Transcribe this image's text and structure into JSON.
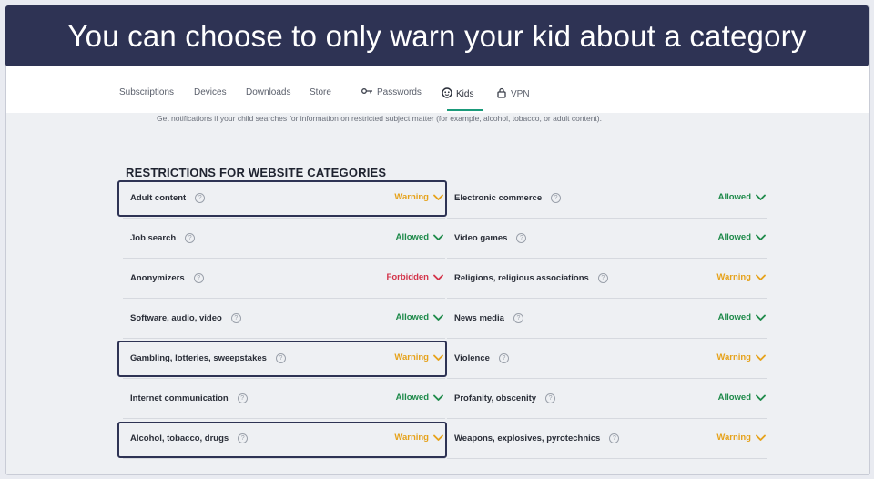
{
  "banner": {
    "text": "You can choose to only warn your kid about a category"
  },
  "nav": {
    "items": [
      {
        "label": "Subscriptions",
        "icon": null
      },
      {
        "label": "Devices",
        "icon": null
      },
      {
        "label": "Downloads",
        "icon": null
      },
      {
        "label": "Store",
        "icon": null
      },
      {
        "label": "Passwords",
        "icon": "key-icon"
      },
      {
        "label": "Kids",
        "icon": "kids-icon",
        "active": true
      },
      {
        "label": "VPN",
        "icon": "lock-icon"
      }
    ]
  },
  "notice": "Get notifications if your child searches for information on restricted subject matter (for example, alcohol, tobacco, or adult content).",
  "section_title": "RESTRICTIONS FOR WEBSITE CATEGORIES",
  "help_glyph": "?",
  "categories": {
    "left": [
      {
        "label": "Adult content",
        "status": "Warning"
      },
      {
        "label": "Job search",
        "status": "Allowed"
      },
      {
        "label": "Anonymizers",
        "status": "Forbidden"
      },
      {
        "label": "Software, audio, video",
        "status": "Allowed"
      },
      {
        "label": "Gambling, lotteries, sweepstakes",
        "status": "Warning"
      },
      {
        "label": "Internet communication",
        "status": "Allowed"
      },
      {
        "label": "Alcohol, tobacco, drugs",
        "status": "Warning"
      }
    ],
    "right": [
      {
        "label": "Electronic commerce",
        "status": "Allowed"
      },
      {
        "label": "Video games",
        "status": "Allowed"
      },
      {
        "label": "Religions, religious associations",
        "status": "Warning"
      },
      {
        "label": "News media",
        "status": "Allowed"
      },
      {
        "label": "Violence",
        "status": "Warning"
      },
      {
        "label": "Profanity, obscenity",
        "status": "Allowed"
      },
      {
        "label": "Weapons, explosives, pyrotechnics",
        "status": "Warning"
      }
    ]
  },
  "colors": {
    "banner_bg": "#2e3354",
    "allowed": "#1e8a4a",
    "warning": "#e6a21a",
    "forbidden": "#d3344a",
    "accent": "#1a9a7a"
  }
}
